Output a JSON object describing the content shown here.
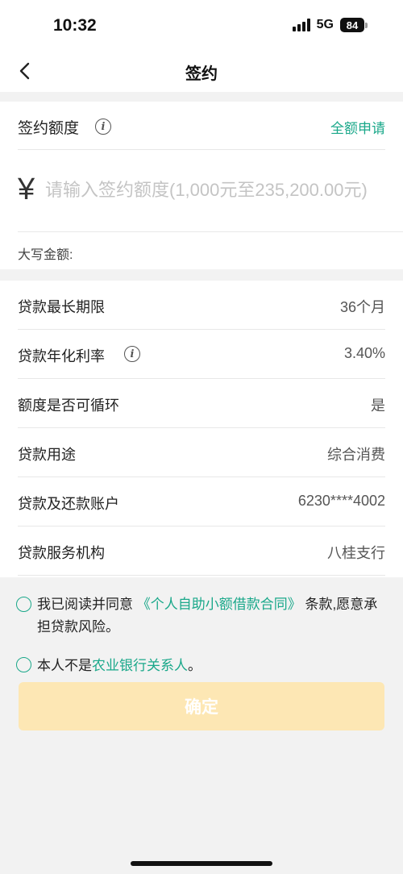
{
  "status": {
    "time": "10:32",
    "network": "5G",
    "battery": "84"
  },
  "nav": {
    "title": "签约"
  },
  "amount": {
    "label": "签约额度",
    "full_apply": "全额申请",
    "currency": "¥",
    "placeholder": "请输入签约额度(1,000元至235,200.00元)",
    "capital_label": "大写金额:"
  },
  "details": {
    "rows": [
      {
        "label": "贷款最长期限",
        "value": "36个月"
      },
      {
        "label": "贷款年化利率",
        "value": "3.40%"
      },
      {
        "label": "额度是否可循环",
        "value": "是"
      },
      {
        "label": "贷款用途",
        "value": "综合消费"
      },
      {
        "label": "贷款及还款账户",
        "value": "6230****4002"
      },
      {
        "label": "贷款服务机构",
        "value": "八桂支行"
      }
    ]
  },
  "agreements": {
    "contract_prefix": "我已阅读并同意",
    "contract_link": "《个人自助小额借款合同》",
    "contract_suffix": "条款,愿意承担贷款风险。",
    "relation_prefix": "本人不是",
    "relation_link": "农业银行关系人",
    "relation_suffix": "。"
  },
  "confirm": {
    "label": "确定"
  },
  "colors": {
    "accent": "#1aa88a",
    "button_disabled": "#fde7b4",
    "background": "#f2f2f2"
  }
}
